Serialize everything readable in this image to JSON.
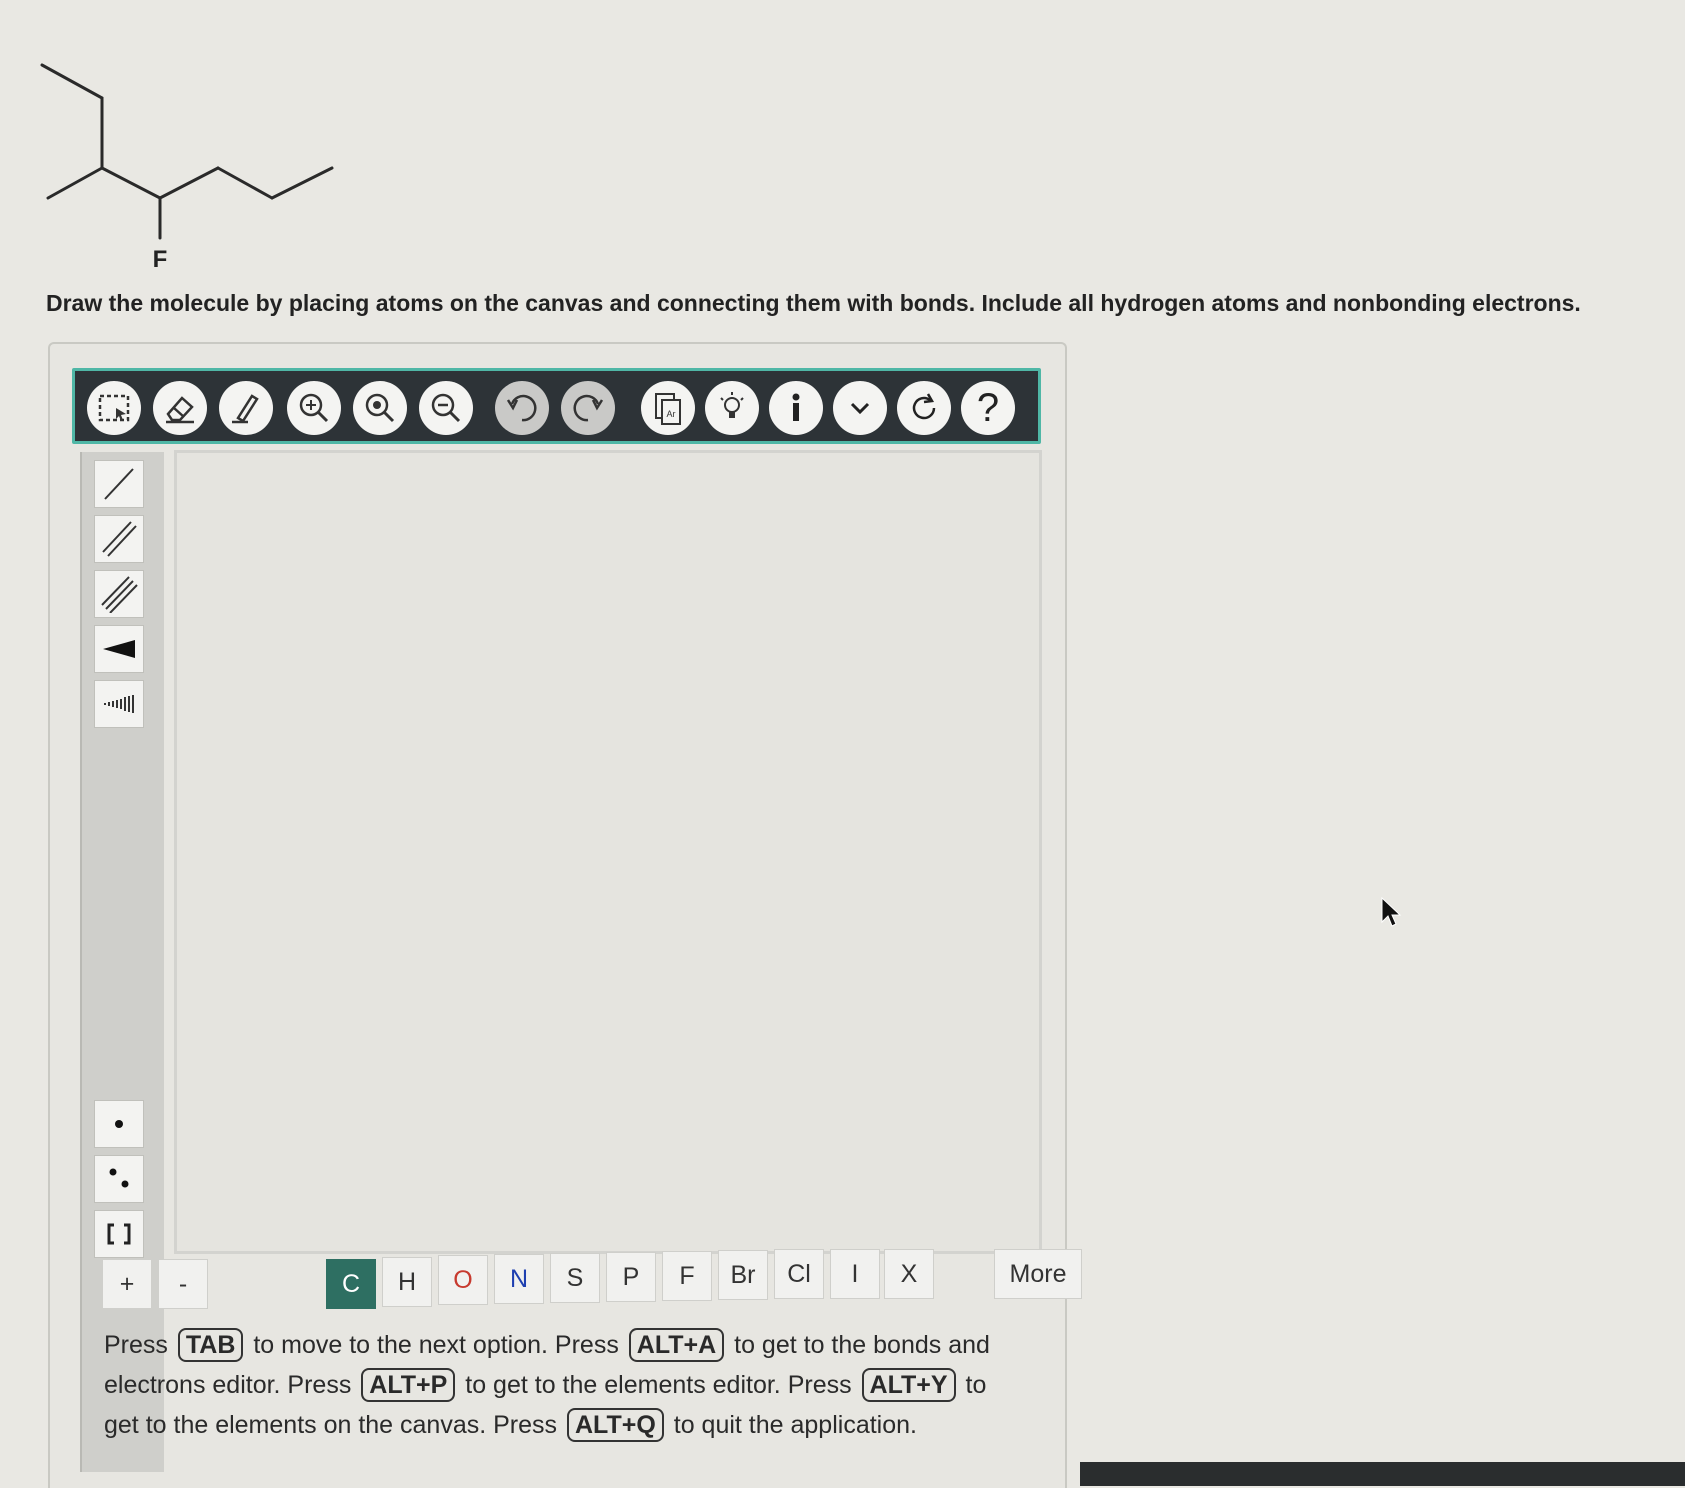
{
  "molecule": {
    "atom_label": "F"
  },
  "instruction": "Draw the molecule by placing atoms on the canvas and connecting them with bonds. Include all hydrogen atoms and nonbonding electrons.",
  "toolbar": {
    "buttons": [
      "select-icon",
      "eraser-icon",
      "pencil-icon",
      "zoom-fit-icon",
      "zoom-in-icon",
      "zoom-out-icon",
      "undo-icon",
      "redo-icon",
      "templates-icon",
      "lightbulb-icon",
      "info-icon",
      "chevron-down-icon",
      "refresh-icon",
      "help-icon"
    ],
    "help_label": "?"
  },
  "bond_tools": [
    "single-bond-icon",
    "double-bond-icon",
    "triple-bond-icon",
    "wedge-bond-icon",
    "hash-bond-icon"
  ],
  "electron_tools": [
    "radical-icon",
    "lone-pair-icon",
    "bracket-icon"
  ],
  "charge": {
    "plus": "+",
    "minus": "-"
  },
  "elements": [
    {
      "symbol": "C",
      "style": "active"
    },
    {
      "symbol": "H",
      "style": ""
    },
    {
      "symbol": "O",
      "style": "red"
    },
    {
      "symbol": "N",
      "style": "blue"
    },
    {
      "symbol": "S",
      "style": ""
    },
    {
      "symbol": "P",
      "style": ""
    },
    {
      "symbol": "F",
      "style": ""
    },
    {
      "symbol": "Br",
      "style": ""
    },
    {
      "symbol": "Cl",
      "style": ""
    },
    {
      "symbol": "I",
      "style": ""
    },
    {
      "symbol": "X",
      "style": ""
    }
  ],
  "more_label": "More",
  "help_text": {
    "press1": "Press",
    "tab": "TAB",
    "t1": "to move to the next option. Press",
    "alt_a": "ALT+A",
    "t2": "to get to the bonds and electrons editor. Press",
    "alt_p": "ALT+P",
    "t3": "to get to the elements editor. Press",
    "alt_y": "ALT+Y",
    "t4": "to get to the elements on the canvas. Press",
    "alt_q": "ALT+Q",
    "t5": "to quit the application."
  },
  "colors": {
    "toolbar_bg": "#2d3337",
    "toolbar_border": "#4fb7a6",
    "active_element": "#2e6f62"
  }
}
